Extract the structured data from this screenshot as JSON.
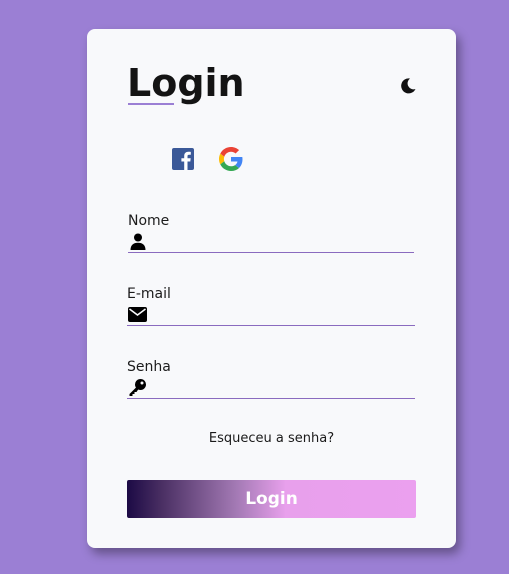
{
  "form": {
    "title": "Login",
    "social": [
      {
        "name": "facebook-icon",
        "color": "#3b5998"
      },
      {
        "name": "google-icon"
      }
    ],
    "fields": [
      {
        "label": "Nome",
        "icon": "user-icon",
        "value": ""
      },
      {
        "label": "E-mail",
        "icon": "envelope-icon",
        "value": ""
      },
      {
        "label": "Senha",
        "icon": "key-icon",
        "value": ""
      }
    ],
    "forgot_link": "Esqueceu a senha?",
    "submit_label": "Login",
    "theme_icon": "moon-icon"
  },
  "colors": {
    "background": "#9b7fd4",
    "card": "#f8f9fb",
    "accent": "#8a6bbf",
    "button_gradient_start": "#1c0a45",
    "button_gradient_end": "#eba0ef"
  }
}
